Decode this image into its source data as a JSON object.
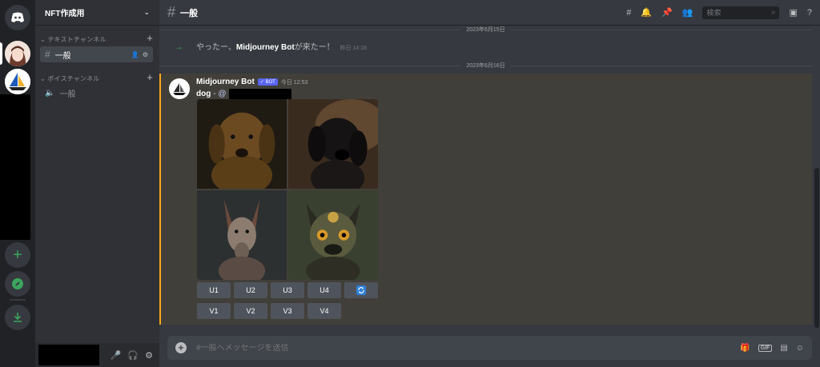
{
  "guild": {
    "name": "NFT作成用"
  },
  "categories": [
    {
      "label": "テキストチャンネル"
    },
    {
      "label": "ボイスチャンネル"
    }
  ],
  "channels": {
    "text": "一般",
    "voice": "一般"
  },
  "header": {
    "channel": "一般",
    "search_placeholder": "検索"
  },
  "dates": {
    "first": "2023年6月15日",
    "second": "2023年6月16日"
  },
  "system_message": {
    "prefix": "やったー、",
    "bot": "Midjourney Bot",
    "suffix": "が来たー！",
    "time": "昨日 14:18"
  },
  "bot_message": {
    "author": "Midjourney Bot",
    "badge": "✓ BOT",
    "time": "今日 12:53",
    "prompt": "dog",
    "separator": " - @"
  },
  "buttons": {
    "upscale": [
      "U1",
      "U2",
      "U3",
      "U4"
    ],
    "variation": [
      "V1",
      "V2",
      "V3",
      "V4"
    ],
    "refresh_icon": "refresh-icon"
  },
  "composer": {
    "placeholder": "#一般へメッセージを送信"
  },
  "colors": {
    "mention_border": "#faa81a",
    "brand": "#5865f2",
    "online": "#3ba55d"
  }
}
